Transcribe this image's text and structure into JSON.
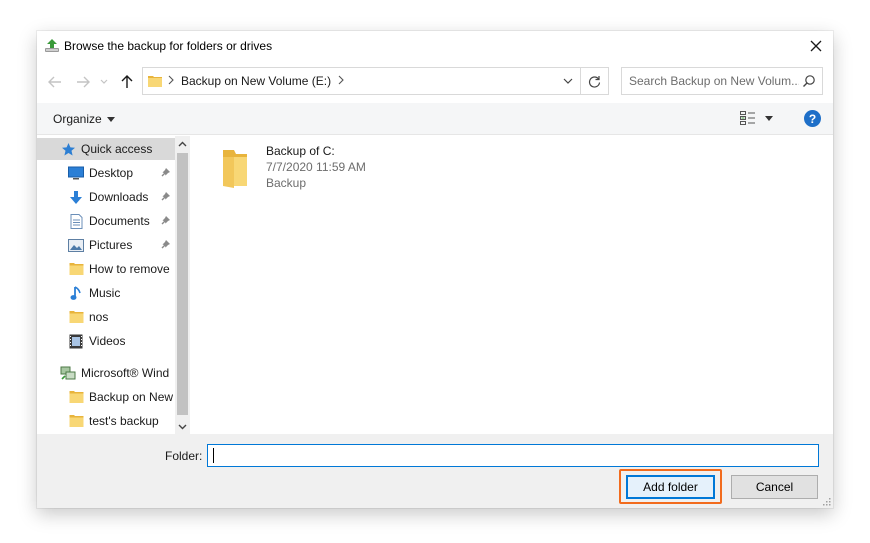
{
  "window": {
    "title": "Browse the backup for folders or drives",
    "title_icon": "backup-browse-icon",
    "close_icon": "close-icon"
  },
  "navigation": {
    "back_icon": "arrow-left-icon",
    "forward_icon": "arrow-right-icon",
    "recent_icon": "chevron-down-icon",
    "up_icon": "arrow-up-icon",
    "address": {
      "path": "Backup on New Volume (E:)",
      "refresh_icon": "refresh-icon"
    },
    "search": {
      "placeholder": "Search Backup on New Volum...",
      "icon": "search-icon"
    }
  },
  "toolbar": {
    "organize_label": "Organize",
    "view_icon": "view-details-icon",
    "help_label": "?"
  },
  "nav_pane": {
    "items": [
      {
        "label": "Quick access",
        "icon": "star-icon",
        "pinned": false,
        "selected": true
      },
      {
        "label": "Desktop",
        "icon": "desktop-icon",
        "pinned": true
      },
      {
        "label": "Downloads",
        "icon": "download-icon",
        "pinned": true
      },
      {
        "label": "Documents",
        "icon": "document-icon",
        "pinned": true
      },
      {
        "label": "Pictures",
        "icon": "pictures-icon",
        "pinned": true
      },
      {
        "label": "How to remove",
        "icon": "folder-icon",
        "pinned": false
      },
      {
        "label": "Music",
        "icon": "music-icon",
        "pinned": false
      },
      {
        "label": "nos",
        "icon": "folder-icon",
        "pinned": false
      },
      {
        "label": "Videos",
        "icon": "video-icon",
        "pinned": false
      },
      {
        "label": "Microsoft® Wind",
        "icon": "network-icon",
        "pinned": false
      },
      {
        "label": "Backup on New",
        "icon": "folder-icon",
        "pinned": false
      },
      {
        "label": "test's backup",
        "icon": "folder-icon",
        "pinned": false
      }
    ]
  },
  "content": {
    "items": [
      {
        "name": "Backup of C:",
        "date": "7/7/2020 11:59 AM",
        "type": "Backup",
        "icon": "folder-icon"
      }
    ]
  },
  "footer": {
    "folder_label": "Folder:",
    "folder_value": "",
    "add_folder_label": "Add folder",
    "cancel_label": "Cancel"
  },
  "colors": {
    "accent": "#0078d7",
    "highlight": "#f26b1d",
    "folder": "#f8d775",
    "selected": "#d9d9d9"
  }
}
